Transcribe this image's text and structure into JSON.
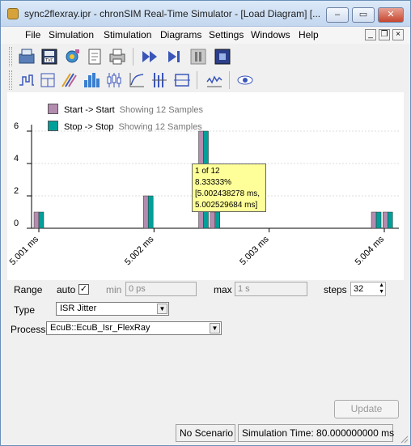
{
  "window": {
    "title": "sync2flexray.ipr - chronSIM Real-Time Simulator - [Load Diagram] [..."
  },
  "window_controls": {
    "minimize": "‒",
    "maximize": "▭",
    "close": "✕"
  },
  "menu": [
    "File",
    "Simulation",
    "Stimulation",
    "Diagrams",
    "Settings",
    "Windows",
    "Help"
  ],
  "mdi_controls": {
    "minimize": "_",
    "restore": "❐",
    "close": "×"
  },
  "toolbar_row1": [
    "open-project-icon",
    "save-tvc-icon",
    "settings-gear-icon",
    "document-icon",
    "print-icon",
    "fast-forward-icon",
    "step-forward-icon",
    "pause-icon",
    "stop-icon"
  ],
  "toolbar_row2": [
    "step-diagram-icon",
    "stack-diagram-icon",
    "trace-diagram-icon",
    "histogram-icon",
    "candlestick-icon",
    "curve-diagram-icon",
    "bar-range-icon",
    "span-diagram-icon",
    "jitter-diagram-icon",
    "eye-icon"
  ],
  "chart_data": {
    "type": "bar",
    "ylim": [
      0,
      7
    ],
    "y_ticks": [
      "0",
      "2",
      "4",
      "6"
    ],
    "x_ticks": [
      "5.001 ms",
      "5.002 ms",
      "5.003 ms",
      "5.004 ms"
    ],
    "series": [
      {
        "name": "Start -> Start",
        "note": "Showing 12 Samples",
        "color": "#b48cb0",
        "x": [
          5.001,
          5.00195,
          5.00243,
          5.00253,
          5.00393,
          5.00403
        ],
        "values": [
          1,
          2,
          6,
          1,
          1,
          1
        ]
      },
      {
        "name": "Stop -> Stop",
        "note": "Showing 12 Samples",
        "color": "#00a09a",
        "x": [
          5.001,
          5.00195,
          5.00243,
          5.00253,
          5.00393,
          5.00403
        ],
        "values": [
          1,
          2,
          6,
          1,
          1,
          1
        ]
      }
    ],
    "tooltip": [
      "1 of 12",
      "8.33333%",
      "[5.002438278 ms,",
      " 5.002529684 ms]"
    ]
  },
  "form": {
    "range_label": "Range",
    "auto_label": "auto",
    "auto_checked": "✓",
    "min_label": "min",
    "min_value": "0 ps",
    "max_label": "max",
    "max_value": "1 s",
    "steps_label": "steps",
    "steps_value": "32",
    "type_label": "Type",
    "type_value": "ISR Jitter",
    "process_label": "Process",
    "process_value": "EcuB::EcuB_Isr_FlexRay",
    "update_button": "Update"
  },
  "status": {
    "scenario": "No Scenario",
    "simulation_time": "Simulation Time: 80.000000000 ms"
  }
}
